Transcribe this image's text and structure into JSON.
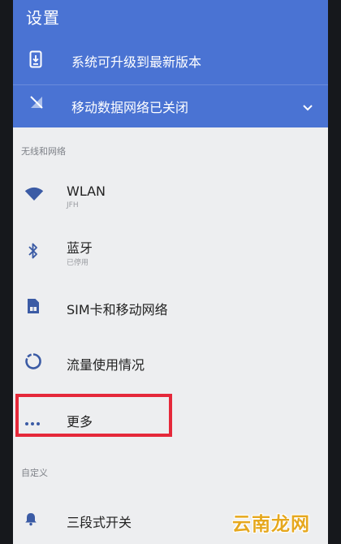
{
  "header": {
    "title": "设置"
  },
  "notices": {
    "update_label": "系统可升级到最新版本",
    "mobile_data_label": "移动数据网络已关闭"
  },
  "sections": {
    "wireless_header": "无线和网络",
    "custom_header": "自定义"
  },
  "items": {
    "wlan": {
      "title": "WLAN",
      "subtitle": "JFH"
    },
    "bluetooth": {
      "title": "蓝牙",
      "subtitle": "已停用"
    },
    "sim": {
      "title": "SIM卡和移动网络"
    },
    "data_usage": {
      "title": "流量使用情况"
    },
    "more": {
      "title": "更多"
    },
    "three_stage": {
      "title": "三段式开关"
    }
  },
  "watermark": "云南龙网",
  "colors": {
    "accent": "#4a73d3",
    "icon": "#3b5ba5",
    "highlight": "#e5283a",
    "watermark": "#e6a81e"
  },
  "icons": {
    "update": "phone-download-icon",
    "mobile_data": "signal-off-icon",
    "expand": "chevron-down-icon",
    "wlan": "wifi-icon",
    "bluetooth": "bluetooth-icon",
    "sim": "sim-card-icon",
    "data_usage": "data-usage-icon",
    "more": "more-dots-icon",
    "three_stage": "bell-icon"
  }
}
